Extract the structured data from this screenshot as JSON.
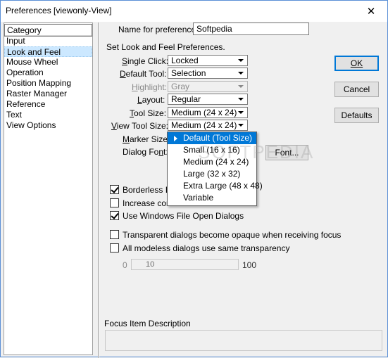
{
  "window": {
    "title": "Preferences [viewonly-View]",
    "close_glyph": "✕"
  },
  "category": {
    "header": "Category",
    "items": [
      "Input",
      "Look and Feel",
      "Mouse Wheel",
      "Operation",
      "Position Mapping",
      "Raster Manager",
      "Reference",
      "Text",
      "View Options"
    ],
    "selected": "Look and Feel"
  },
  "name_pref": {
    "label": "Name for preferences",
    "value": "Softpedia"
  },
  "section_title": "Set Look and Feel Preferences.",
  "fields": {
    "single_click": {
      "label": "Single Click:",
      "value": "Locked"
    },
    "default_tool": {
      "label": "Default Tool:",
      "value": "Selection"
    },
    "highlight": {
      "label": "Highlight:",
      "value": "Gray"
    },
    "layout": {
      "label": "Layout:",
      "value": "Regular"
    },
    "tool_size": {
      "label": "Tool Size:",
      "value": "Medium (24 x 24)"
    },
    "view_tool_size": {
      "label": "View Tool Size:",
      "value": "Medium (24 x 24)"
    },
    "marker_size": {
      "label": "Marker Size:"
    },
    "dialog_font": {
      "label": "Dialog Font:"
    }
  },
  "marker_size_options": [
    "Default (Tool Size)",
    "Small (16 x 16)",
    "Medium (24 x 24)",
    "Large (32 x 32)",
    "Extra Large (48 x 48)",
    "Variable"
  ],
  "marker_size_selected": "Default (Tool Size)",
  "buttons": {
    "ok": "OK",
    "cancel": "Cancel",
    "defaults": "Defaults",
    "font": "Font..."
  },
  "checkboxes": {
    "borderless": {
      "label": "Borderless Ico",
      "checked": true
    },
    "increase": {
      "label": "Increase cont",
      "checked": false
    },
    "windows_dialogs": {
      "label": "Use Windows File Open Dialogs",
      "checked": true
    },
    "transparent": {
      "label": "Transparent dialogs become opaque when receiving focus",
      "checked": false
    },
    "modeless": {
      "label": "All modeless dialogs use same transparency",
      "checked": false
    }
  },
  "transparency": {
    "min": "0",
    "value": "10",
    "max": "100"
  },
  "focus_desc": {
    "label": "Focus Item Description"
  },
  "watermark": "SOFTPEDIA"
}
